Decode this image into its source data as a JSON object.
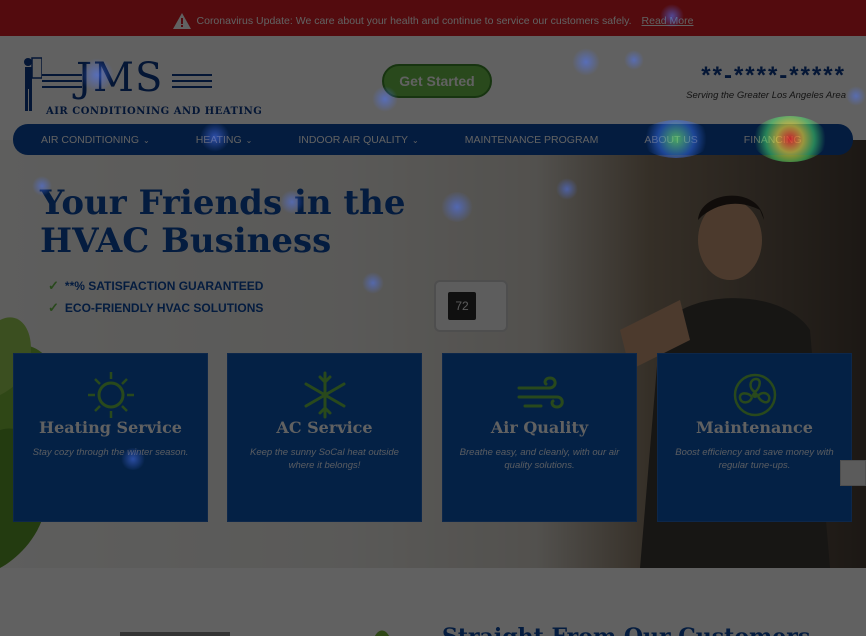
{
  "alert": {
    "text": "Coronavirus Update: We care about your health and continue to service our customers safely.",
    "link": "Read More"
  },
  "header": {
    "logo_text": "JMS",
    "logo_sub": "AIR CONDITIONING AND HEATING",
    "cta": "Get Started",
    "phone": "**-****-*****",
    "service_area": "Serving the Greater Los Angeles Area"
  },
  "nav": {
    "items": [
      {
        "label": "AIR CONDITIONING",
        "caret": "⌄"
      },
      {
        "label": "HEATING",
        "caret": "⌄"
      },
      {
        "label": "INDOOR AIR QUALITY",
        "caret": "⌄"
      },
      {
        "label": "MAINTENANCE PROGRAM",
        "caret": ""
      },
      {
        "label": "ABOUT US",
        "caret": ""
      },
      {
        "label": "FINANCING",
        "caret": ""
      }
    ]
  },
  "hero": {
    "headline_line1": "Your Friends in the",
    "headline_line2": "HVAC Business",
    "bullets": [
      "**% SATISFACTION GUARANTEED",
      "ECO-FRIENDLY HVAC SOLUTIONS"
    ],
    "thermostat_value": "72"
  },
  "cards": [
    {
      "title": "Heating Service",
      "desc": "Stay cozy through the winter season.",
      "icon": "sun-icon"
    },
    {
      "title": "AC Service",
      "desc": "Keep the sunny SoCal heat outside where it belongs!",
      "icon": "snowflake-icon"
    },
    {
      "title": "Air Quality",
      "desc": "Breathe easy, and cleanly, with our air quality solutions.",
      "icon": "wind-icon"
    },
    {
      "title": "Maintenance",
      "desc": "Boost efficiency and save money with regular tune-ups.",
      "icon": "fan-icon"
    }
  ],
  "below": {
    "title": "Straight From Our Customers"
  },
  "colors": {
    "brand_blue": "#0d4aa6",
    "alert_red": "#d91f26",
    "cta_green": "#6cc04a"
  }
}
